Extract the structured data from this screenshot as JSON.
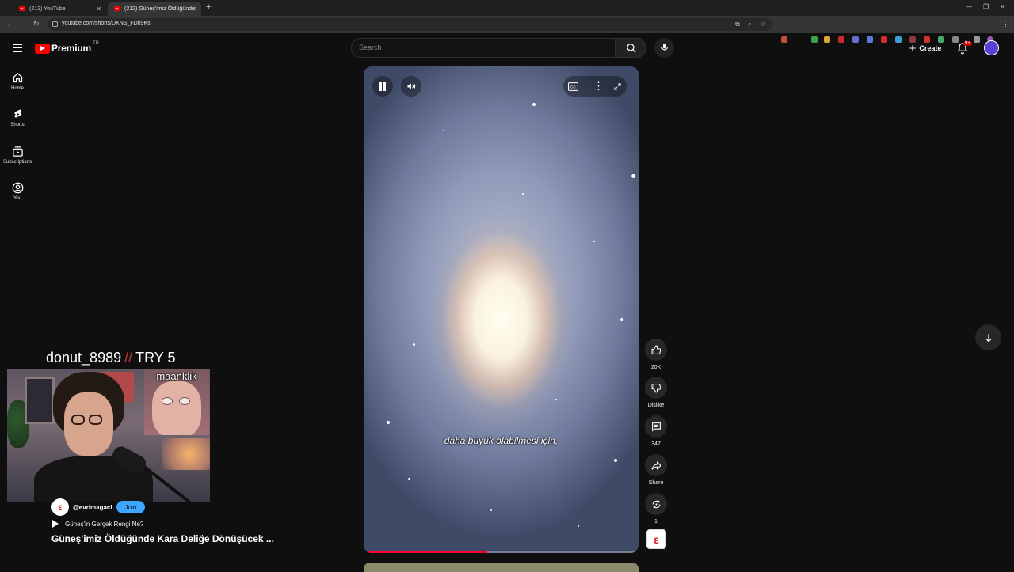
{
  "browser": {
    "tabs": [
      {
        "title": "(212) YouTube",
        "active": false
      },
      {
        "title": "(212) Güneş'imiz Öldüğünde",
        "active": true
      }
    ],
    "url": "youtube.com/shorts/DKNS_FDh9Ks"
  },
  "header": {
    "logo_text": "Premium",
    "country_code": "TR",
    "search_placeholder": "Search",
    "create_label": "Create",
    "notif_count": "9+"
  },
  "sidebar": {
    "items": [
      {
        "label": "Home",
        "icon": "home-icon"
      },
      {
        "label": "Shorts",
        "icon": "shorts-icon"
      },
      {
        "label": "Subscriptions",
        "icon": "subscriptions-icon"
      },
      {
        "label": "You",
        "icon": "you-icon"
      }
    ]
  },
  "video": {
    "caption": "daha büyük olabilmesi için,",
    "progress": 0.45
  },
  "actions": {
    "likes": "20K",
    "dislike_label": "Dislike",
    "comments": "347",
    "share_label": "Share",
    "remix_count": "1"
  },
  "channel": {
    "handle": "@evrimagaci",
    "join_label": "Join",
    "related_label": "Güneş'in Gerçek Rengi Ne?",
    "title": "Güneş'imiz Öldüğünde Kara Deliğe Dönüşücek ..."
  },
  "stream_overlay": {
    "streamer": "donut_8989",
    "separator": "//",
    "attempt": "TRY 5",
    "pip_name": "maanklik"
  },
  "colors": {
    "yt_red": "#ff0000",
    "join_blue": "#3ea6ff",
    "progress_red": "#ff0033"
  }
}
